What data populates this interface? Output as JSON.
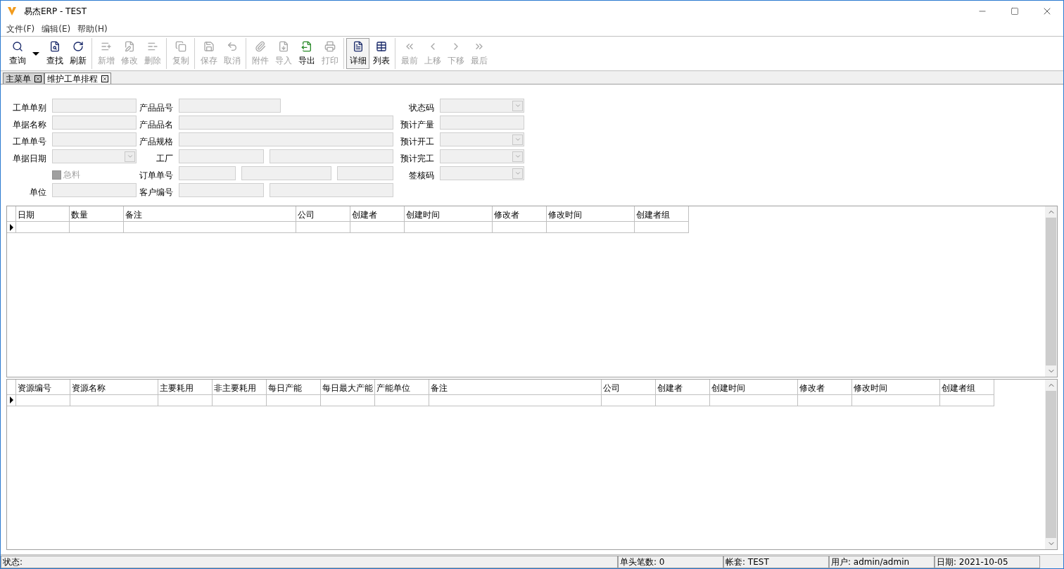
{
  "window": {
    "title": "易杰ERP - TEST"
  },
  "menu": [
    "文件(F)",
    "编辑(E)",
    "帮助(H)"
  ],
  "toolbar": [
    [
      {
        "label": "查询",
        "disabled": false,
        "dropdown": true
      },
      {
        "label": "查找",
        "disabled": false
      },
      {
        "label": "刷新",
        "disabled": false
      }
    ],
    [
      {
        "label": "新增",
        "disabled": true
      },
      {
        "label": "修改",
        "disabled": true
      },
      {
        "label": "删除",
        "disabled": true
      }
    ],
    [
      {
        "label": "复制",
        "disabled": true
      }
    ],
    [
      {
        "label": "保存",
        "disabled": true
      },
      {
        "label": "取消",
        "disabled": true
      }
    ],
    [
      {
        "label": "附件",
        "disabled": true
      },
      {
        "label": "导入",
        "disabled": true
      },
      {
        "label": "导出",
        "disabled": false
      },
      {
        "label": "打印",
        "disabled": true
      }
    ],
    [
      {
        "label": "详细",
        "disabled": false,
        "selected": true
      },
      {
        "label": "列表",
        "disabled": false,
        "selected": false
      }
    ],
    [
      {
        "label": "最前",
        "disabled": true
      },
      {
        "label": "上移",
        "disabled": true
      },
      {
        "label": "下移",
        "disabled": true
      },
      {
        "label": "最后",
        "disabled": true
      }
    ]
  ],
  "tabs": [
    {
      "label": "主菜单",
      "selected": false
    },
    {
      "label": "维护工单排程",
      "selected": true
    }
  ],
  "form": {
    "left": [
      {
        "kind": "text",
        "label": "工单单别"
      },
      {
        "kind": "text",
        "label": "单据名称"
      },
      {
        "kind": "text",
        "label": "工单单号"
      },
      {
        "kind": "dropdown",
        "label": "单据日期"
      },
      {
        "kind": "checkbox",
        "label": "急料",
        "checked": false,
        "disabled": true
      },
      {
        "kind": "text",
        "label": "单位"
      }
    ],
    "middle": [
      {
        "kind": "short",
        "label": "产品品号"
      },
      {
        "kind": "wide",
        "label": "产品品名"
      },
      {
        "kind": "wide",
        "label": "产品规格"
      },
      {
        "kind": "pair",
        "label": "工厂"
      },
      {
        "kind": "triple",
        "label": "订单单号"
      },
      {
        "kind": "pair",
        "label": "客户编号"
      }
    ],
    "right": [
      {
        "kind": "dropdown",
        "label": "状态码"
      },
      {
        "kind": "text",
        "label": "预计产量"
      },
      {
        "kind": "dropdown",
        "label": "预计开工"
      },
      {
        "kind": "dropdown",
        "label": "预计完工"
      },
      {
        "kind": "dropdown",
        "label": "签核码"
      }
    ]
  },
  "grid_top": {
    "columns": [
      "日期",
      "数量",
      "备注",
      "公司",
      "创建者",
      "创建时间",
      "修改者",
      "修改时间",
      "创建者组"
    ]
  },
  "grid_bottom": {
    "columns": [
      "资源编号",
      "资源名称",
      "主要耗用",
      "非主要耗用",
      "每日产能",
      "每日最大产能",
      "产能单位",
      "备注",
      "公司",
      "创建者",
      "创建时间",
      "修改者",
      "修改时间",
      "创建者组"
    ]
  },
  "status_bar": [
    "状态:",
    "单头笔数: 0",
    "帐套: TEST",
    "用户: admin/admin",
    "日期: 2021-10-05"
  ]
}
